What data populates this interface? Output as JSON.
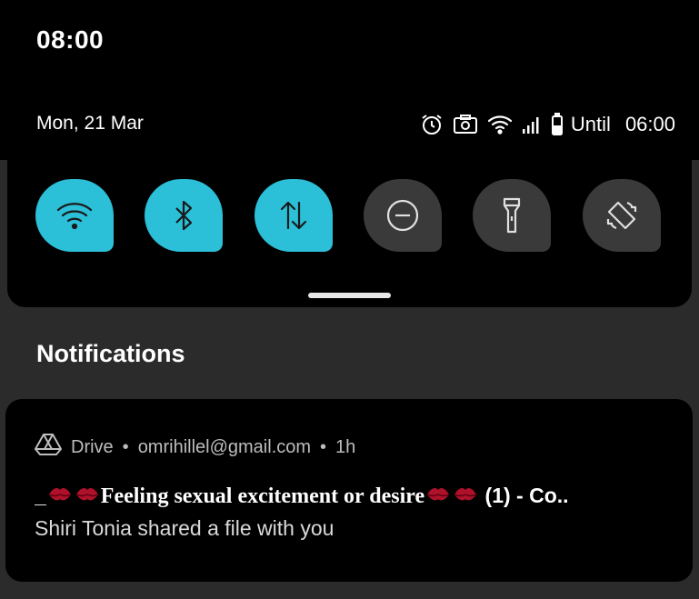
{
  "status": {
    "time": "08:00",
    "date": "Mon, 21 Mar",
    "alarm_until_label": "Until",
    "alarm_until_time": "06:00"
  },
  "quick_tiles": [
    {
      "icon": "wifi-icon",
      "state": "on"
    },
    {
      "icon": "bluetooth-icon",
      "state": "on"
    },
    {
      "icon": "mobile-data-icon",
      "state": "on"
    },
    {
      "icon": "do-not-disturb-icon",
      "state": "off"
    },
    {
      "icon": "flashlight-icon",
      "state": "off"
    },
    {
      "icon": "auto-rotate-icon",
      "state": "off"
    }
  ],
  "notifications": {
    "title": "Notifications",
    "items": [
      {
        "app": "Drive",
        "account": "omrihillel@gmail.com",
        "time": "1h",
        "title_prefix": "_",
        "title_main": "Feeling sexual excitement or desire",
        "title_suffix": "(1) - Co..",
        "text": "Shiri Tonia shared a file with you"
      }
    ]
  },
  "colors": {
    "tile_on": "#2bbfd8",
    "tile_off": "#3a3a3a",
    "background": "#2b2b2b",
    "panel": "#000000"
  }
}
